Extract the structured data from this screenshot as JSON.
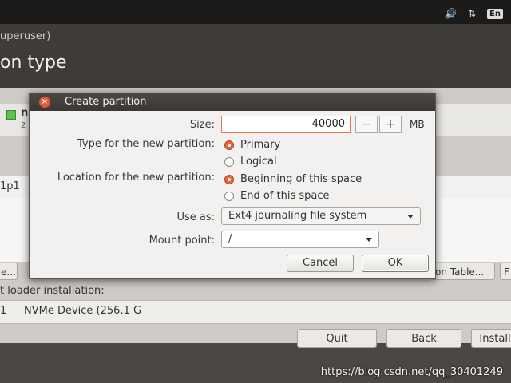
{
  "topbar": {
    "lang": "En"
  },
  "header": {
    "window_title": "uperuser)",
    "page_title": "on type"
  },
  "partition_bar": {
    "name": "n",
    "sub": "2"
  },
  "device_row": {
    "text": "1p1"
  },
  "side_buttons": {
    "left": "e...",
    "partition_table": "on Table...",
    "right": "F"
  },
  "bootloader": {
    "label": "t loader installation:",
    "num": "1",
    "device": "NVMe Device (256.1 G"
  },
  "bottom": {
    "quit": "Quit",
    "back": "Back",
    "install": "Install"
  },
  "dialog": {
    "title": "Create partition",
    "size_label": "Size:",
    "size_value": "40000",
    "minus": "−",
    "plus": "+",
    "unit": "MB",
    "type_label": "Type for the new partition:",
    "type_options": [
      "Primary",
      "Logical"
    ],
    "type_selected": "Primary",
    "location_label": "Location for the new partition:",
    "location_options": [
      "Beginning of this space",
      "End of this space"
    ],
    "location_selected": "Beginning of this space",
    "use_as_label": "Use as:",
    "use_as_value": "Ext4 journaling file system",
    "mount_label": "Mount point:",
    "mount_value": "/",
    "cancel": "Cancel",
    "ok": "OK"
  },
  "watermark": "https://blog.csdn.net/qq_30401249",
  "colors": {
    "accent": "#e8643c",
    "titlebar": "#3a3835",
    "dialog_bg": "#f2f1f0"
  }
}
